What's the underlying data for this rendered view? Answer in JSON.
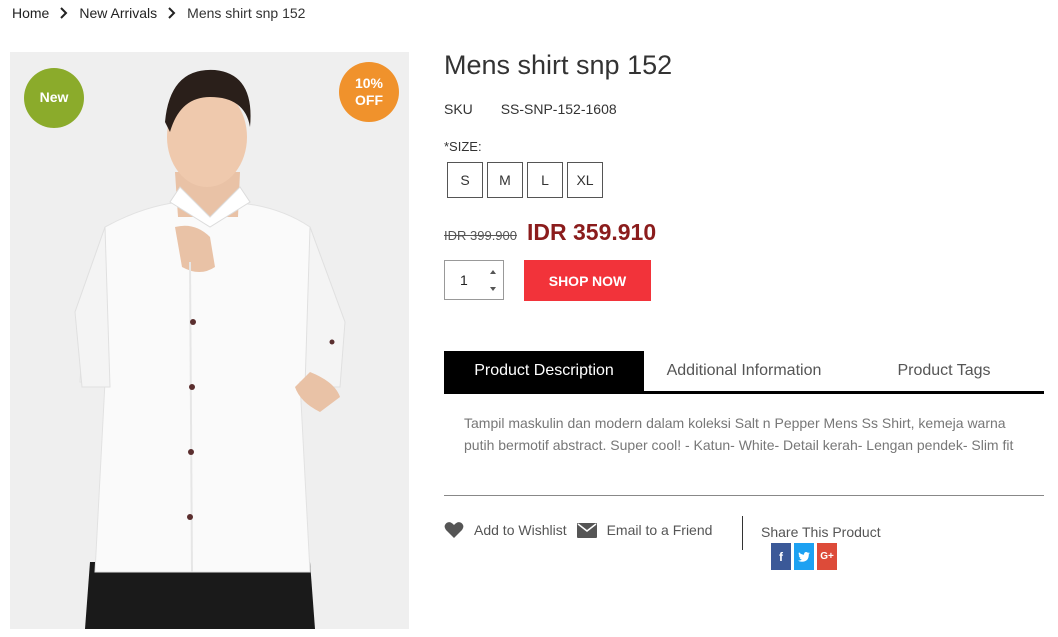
{
  "breadcrumb": {
    "items": [
      "Home",
      "New Arrivals",
      "Mens shirt snp 152"
    ]
  },
  "image": {
    "badge_new": "New",
    "badge_discount_line1": "10%",
    "badge_discount_line2": "OFF"
  },
  "product": {
    "title": "Mens shirt snp 152",
    "sku_label": "SKU",
    "sku_value": "SS-SNP-152-1608",
    "size_label": "*SIZE:",
    "sizes": [
      "S",
      "M",
      "L",
      "XL"
    ],
    "old_price": "IDR 399.900",
    "new_price": "IDR 359.910",
    "quantity": "1",
    "shop_now_label": "SHOP NOW"
  },
  "tabs": [
    {
      "label": "Product Description",
      "active": true
    },
    {
      "label": "Additional Information",
      "active": false
    },
    {
      "label": "Product Tags",
      "active": false
    }
  ],
  "description": "Tampil maskulin dan modern dalam koleksi Salt n Pepper Mens Ss Shirt, kemeja warna putih bermotif abstract. Super cool! - Katun- White- Detail kerah- Lengan pendek- Slim fit",
  "actions": {
    "wishlist": "Add to Wishlist",
    "email": "Email to a Friend",
    "share_label": "Share This Product",
    "share_icons": [
      "facebook-icon",
      "twitter-icon",
      "google-plus-icon"
    ]
  },
  "colors": {
    "badge_new": "#8bab2b",
    "badge_discount": "#f0922c",
    "price": "#8b1c1c",
    "shop_now": "#f2333a",
    "tab_active_bg": "#000000"
  }
}
